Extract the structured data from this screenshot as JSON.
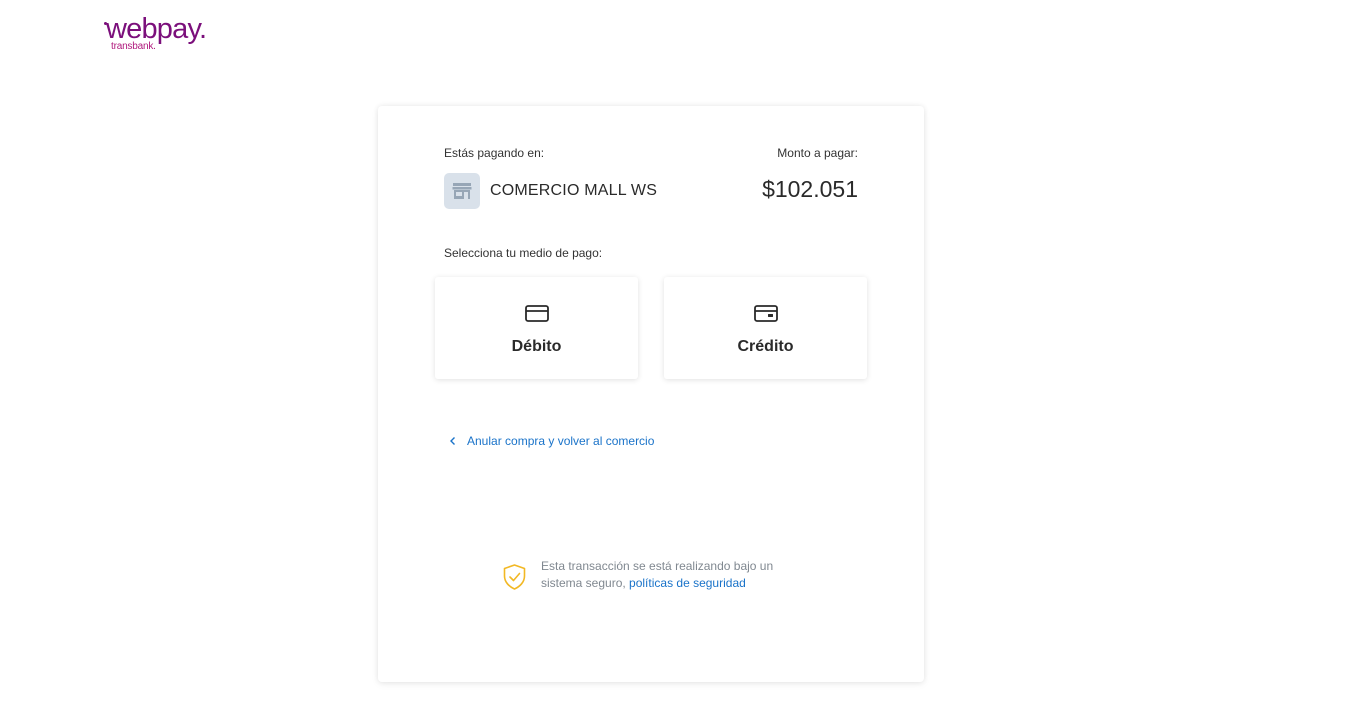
{
  "logo": {
    "main": "webpay.",
    "sub": "transbank."
  },
  "payment": {
    "paying_label": "Estás pagando en:",
    "merchant_name": "COMERCIO MALL WS",
    "amount_label": "Monto a pagar:",
    "amount": "$102.051",
    "merchant_icon": "store-icon"
  },
  "methods": {
    "select_label": "Selecciona tu medio de pago:",
    "items": [
      {
        "label": "Débito",
        "icon": "debit-card-icon"
      },
      {
        "label": "Crédito",
        "icon": "credit-card-icon"
      }
    ]
  },
  "cancel": {
    "label": "Anular compra y volver al comercio",
    "icon": "chevron-left-icon"
  },
  "security": {
    "text_line1": "Esta transacción se está realizando bajo un",
    "text_line2": "sistema seguro,",
    "link": "políticas de seguridad",
    "icon": "shield-check-icon"
  },
  "colors": {
    "brand": "#7b0f7b",
    "link": "#1a73c9",
    "shield": "#f2b824",
    "merchant_icon_bg": "#d9e1ea"
  }
}
